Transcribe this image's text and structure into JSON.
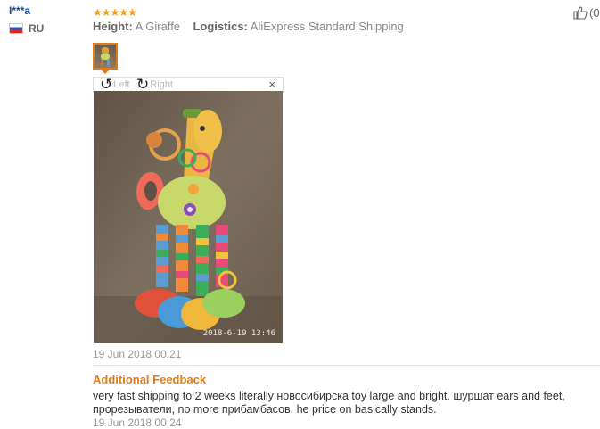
{
  "review": {
    "user_name": "I***a",
    "country": "RU",
    "stars": "★★★★★",
    "height_label": "Height:",
    "height_value": "A Giraffe",
    "logistics_label": "Logistics:",
    "logistics_value": "AliExpress Standard Shipping",
    "helpful_count": "(0",
    "toolbar": {
      "left_label": "Left",
      "right_label": "Right",
      "close": "×"
    },
    "photo_timestamp": "2018-6-19 13:46",
    "date": "19 Jun 2018 00:21",
    "additional_title": "Additional Feedback",
    "additional_text": "very fast shipping to 2 weeks literally новосибирска toy large and bright. шуршат ears and feet, прорезыватели, no more прибамбасов. he price on basically stands.",
    "additional_date": "19 Jun 2018 00:24"
  },
  "colors": {
    "accent": "#e07b1a",
    "star": "#f39c12",
    "username": "#0a4ea3"
  },
  "icons": {
    "thumbs_up": "thumbs-up-icon",
    "rotate_left": "rotate-left-icon",
    "rotate_right": "rotate-right-icon",
    "close": "close-icon",
    "flag": "flag-ru-icon"
  }
}
